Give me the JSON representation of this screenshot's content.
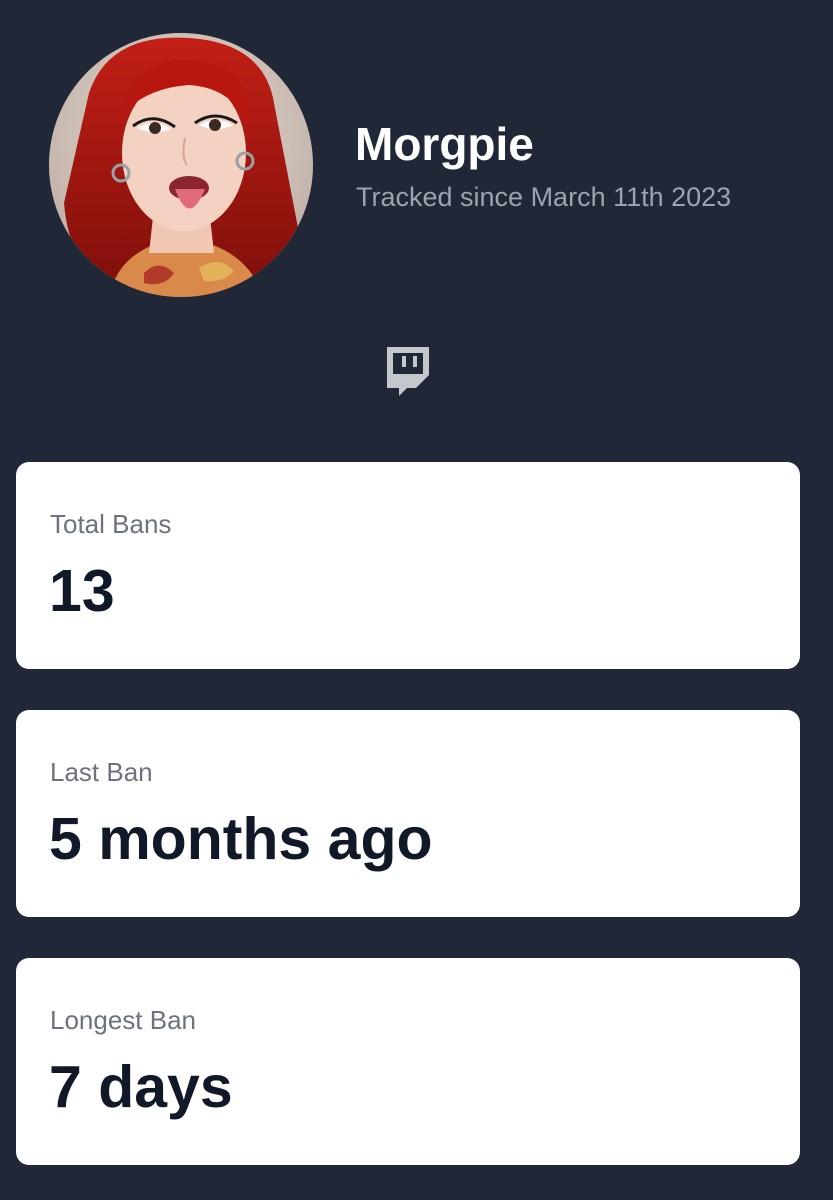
{
  "profile": {
    "display_name": "Morgpie",
    "tracked_since": "Tracked since March 11th 2023",
    "avatar_alt": "Morgpie avatar"
  },
  "platform": {
    "icon": "twitch-icon"
  },
  "stats": [
    {
      "label": "Total Bans",
      "value": "13"
    },
    {
      "label": "Last Ban",
      "value": "5 months ago"
    },
    {
      "label": "Longest Ban",
      "value": "7 days"
    }
  ],
  "colors": {
    "background": "#202838",
    "card": "#ffffff",
    "name": "#ffffff",
    "subtext": "#9ca3af",
    "label": "#6b7280",
    "value": "#111827",
    "icon": "#c4c7cc"
  }
}
